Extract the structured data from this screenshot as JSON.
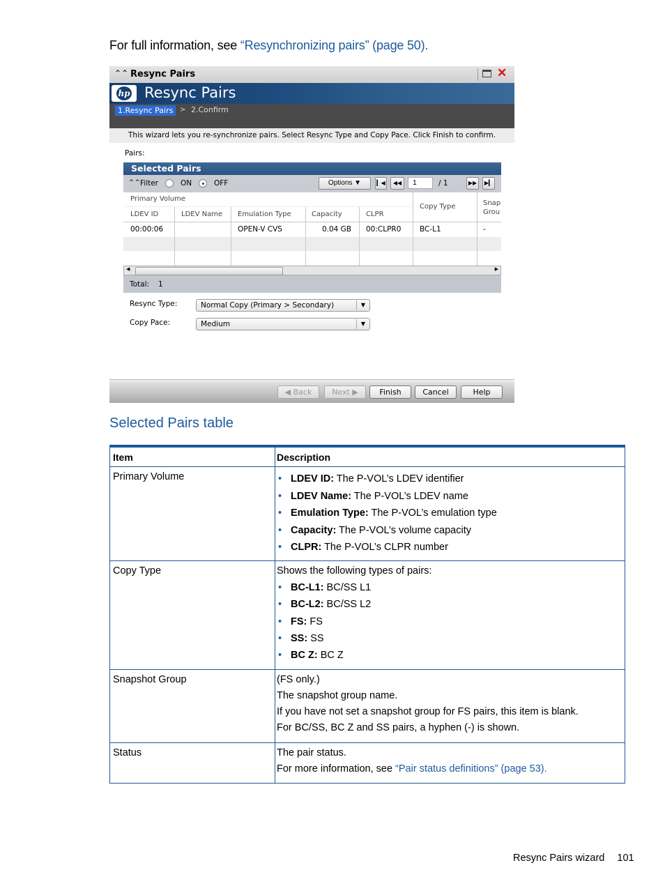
{
  "intro": {
    "prefix": "For full information, see ",
    "link": "“Resynchronizing pairs” (page 50)",
    "suffix": "."
  },
  "wizard": {
    "window_title": "Resync Pairs",
    "banner_title": "Resync Pairs",
    "logo_text": "hp",
    "steps": [
      {
        "label": "1.Resync Pairs",
        "active": true
      },
      {
        "label": "2.Confirm",
        "active": false
      }
    ],
    "step_separator": ">",
    "description": "This wizard lets you re-synchronize pairs. Select Resync Type and Copy Pace. Click Finish to confirm.",
    "pairs_label": "Pairs:",
    "grid": {
      "title": "Selected Pairs",
      "filter_label": "Filter",
      "filter_on": "ON",
      "filter_off": "OFF",
      "filter_selected": "OFF",
      "options_label": "Options",
      "page_current": "1",
      "page_total": "/ 1",
      "group_header": "Primary Volume",
      "columns": [
        "LDEV ID",
        "LDEV Name",
        "Emulation Type",
        "Capacity",
        "CLPR",
        "Copy Type",
        "Snap Grou"
      ],
      "rows": [
        [
          "00:00:06",
          "",
          "OPEN-V CVS",
          "0.04 GB",
          "00:CLPR0",
          "BC-L1",
          "-"
        ]
      ],
      "total_label": "Total:",
      "total_value": "1"
    },
    "resync_type_label": "Resync Type:",
    "resync_type_value": "Normal Copy (Primary > Secondary)",
    "copy_pace_label": "Copy Pace:",
    "copy_pace_value": "Medium",
    "buttons": {
      "back": "Back",
      "next": "Next",
      "finish": "Finish",
      "cancel": "Cancel",
      "help": "Help"
    }
  },
  "section_title": "Selected Pairs table",
  "doc_table": {
    "headers": [
      "Item",
      "Description"
    ],
    "rows": [
      {
        "item": "Primary Volume",
        "lines": [],
        "bullets": [
          {
            "term": "LDEV ID:",
            "text": " The P-VOL’s LDEV identifier"
          },
          {
            "term": "LDEV Name:",
            "text": " The P-VOL’s LDEV name"
          },
          {
            "term": "Emulation Type:",
            "text": " The P-VOL’s emulation type"
          },
          {
            "term": "Capacity:",
            "text": " The P-VOL’s volume capacity"
          },
          {
            "term": "CLPR:",
            "text": " The P-VOL’s CLPR number"
          }
        ]
      },
      {
        "item": "Copy Type",
        "lines": [
          "Shows the following types of pairs:"
        ],
        "bullets": [
          {
            "term": "BC-L1:",
            "text": " BC/SS L1"
          },
          {
            "term": "BC-L2:",
            "text": " BC/SS L2"
          },
          {
            "term": "FS:",
            "text": " FS"
          },
          {
            "term": "SS:",
            "text": " SS"
          },
          {
            "term": "BC Z:",
            "text": " BC Z"
          }
        ]
      },
      {
        "item": "Snapshot Group",
        "lines": [
          "(FS only.)",
          "The snapshot group name.",
          "If you have not set a snapshot group for FS pairs, this item is blank.",
          "For BC/SS, BC Z and SS pairs, a hyphen (-) is shown."
        ],
        "bullets": []
      },
      {
        "item": "Status",
        "lines": [
          "The pair status."
        ],
        "more_prefix": "For more information, see ",
        "more_link": "“Pair status definitions” (page 53)",
        "more_suffix": ".",
        "bullets": []
      }
    ]
  },
  "footer": {
    "section": "Resync Pairs wizard",
    "page": "101"
  }
}
